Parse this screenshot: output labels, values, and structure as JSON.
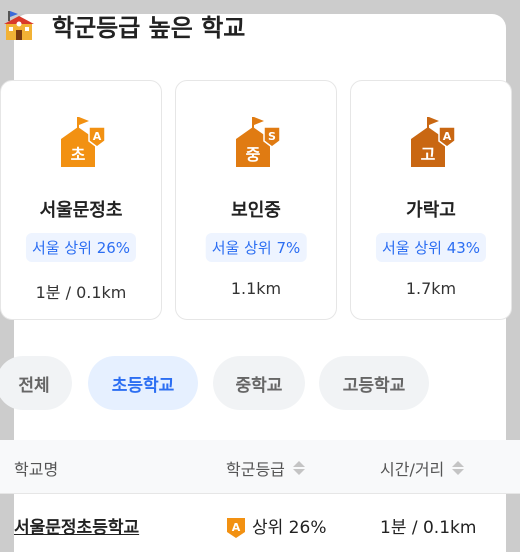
{
  "header": {
    "title": "학군등급 높은 학교",
    "icon": "school-building-icon"
  },
  "cards": [
    {
      "icon_char": "초",
      "grade": "A",
      "color": "#F29112",
      "name": "서울문정초",
      "rank": "서울 상위 26%",
      "distance": "1분 / 0.1km"
    },
    {
      "icon_char": "중",
      "grade": "S",
      "color": "#E07B12",
      "name": "보인중",
      "rank": "서울 상위 7%",
      "distance": "1.1km"
    },
    {
      "icon_char": "고",
      "grade": "A",
      "color": "#C96712",
      "name": "가락고",
      "rank": "서울 상위 43%",
      "distance": "1.7km"
    }
  ],
  "filters": {
    "all": "전체",
    "elementary": "초등학교",
    "middle": "중학교",
    "high": "고등학교",
    "selected": "초등학교"
  },
  "table": {
    "headers": {
      "name": "학교명",
      "grade": "학군등급",
      "time": "시간/거리"
    },
    "rows": [
      {
        "name": "서울문정초등학교",
        "grade_badge": "A",
        "grade": "상위 26%",
        "time": "1분 / 0.1km"
      }
    ]
  },
  "colors": {
    "accent": "#2C6EF2",
    "badge": "#F29112"
  }
}
